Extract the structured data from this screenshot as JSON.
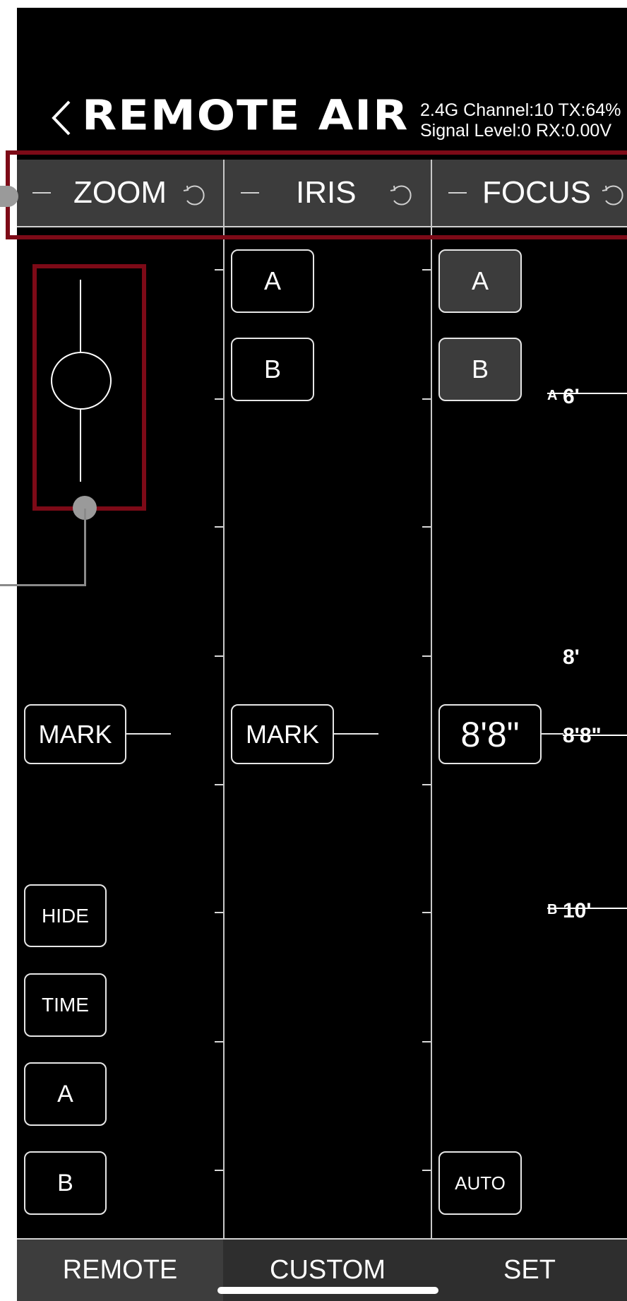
{
  "app": {
    "title": "REMOTE AIR",
    "status_line_1": "2.4G Channel:10 TX:64%",
    "status_line_2": "Signal Level:0 RX:0.00V",
    "highlight_color": "#7d0a17"
  },
  "channels": [
    {
      "title": "ZOOM",
      "minus_icon": "minus-icon",
      "reset_icon": "reset-icon"
    },
    {
      "title": "IRIS",
      "minus_icon": "minus-icon",
      "reset_icon": "reset-icon"
    },
    {
      "title": "FOCUS",
      "minus_icon": "minus-icon",
      "reset_icon": "reset-icon"
    }
  ],
  "zoom": {
    "mark_label": "MARK",
    "buttons": [
      "HIDE",
      "TIME",
      "A",
      "B"
    ]
  },
  "iris": {
    "ab_buttons": [
      "A",
      "B"
    ],
    "mark_label": "MARK"
  },
  "focus": {
    "ab_buttons": [
      "A",
      "B"
    ],
    "mark_value": "8'8\"",
    "auto_label": "AUTO",
    "scale": [
      {
        "label": "6'",
        "marker": "A"
      },
      {
        "label": "8'",
        "marker": ""
      },
      {
        "label": "8'8\"",
        "marker": ""
      },
      {
        "label": "10'",
        "marker": "B"
      }
    ]
  },
  "tabs": [
    "REMOTE",
    "CUSTOM",
    "SET"
  ],
  "active_tab": "REMOTE"
}
